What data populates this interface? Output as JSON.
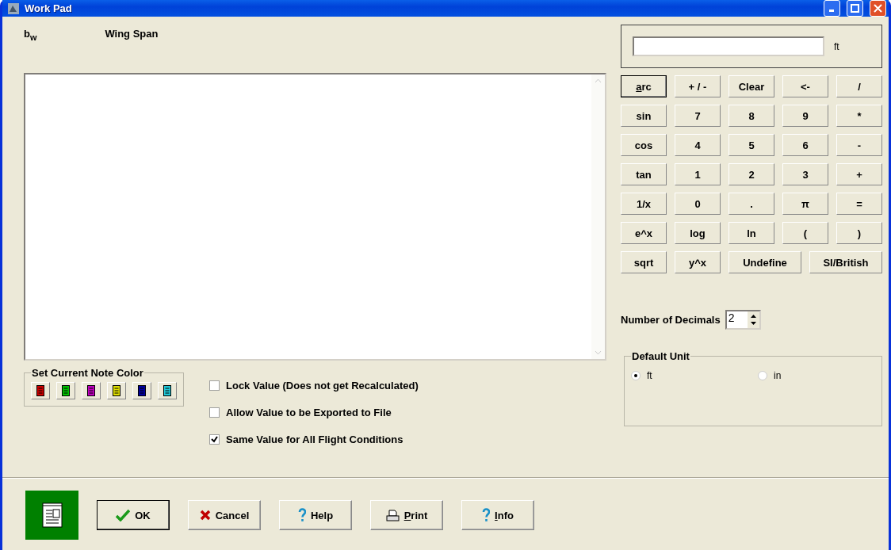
{
  "window": {
    "title": "Work Pad"
  },
  "variable": {
    "symbol": "b",
    "subscript": "w",
    "name": "Wing Span"
  },
  "note_colors": {
    "title": "Set Current Note Color",
    "items": [
      {
        "color": "#d00000"
      },
      {
        "color": "#00c000"
      },
      {
        "color": "#c000c0"
      },
      {
        "color": "#e0e000"
      },
      {
        "color": "#0000a0"
      },
      {
        "color": "#20c8d8"
      }
    ]
  },
  "options": [
    {
      "label": "Lock Value (Does not get Recalculated)",
      "checked": false
    },
    {
      "label": "Allow Value to be Exported to File",
      "checked": false
    },
    {
      "label": "Same Value for All Flight Conditions",
      "checked": true
    }
  ],
  "calculator": {
    "unit": "ft",
    "keys": [
      [
        {
          "label": "arc",
          "kind": "key",
          "underline_first": true,
          "selected": true
        },
        {
          "label": "+ / -",
          "kind": "key"
        },
        {
          "label": "Clear",
          "kind": "key"
        },
        {
          "label": "<-",
          "kind": "key"
        },
        {
          "label": "/",
          "kind": "key"
        }
      ],
      [
        {
          "label": "sin",
          "kind": "key"
        },
        {
          "label": "7",
          "kind": "key"
        },
        {
          "label": "8",
          "kind": "key"
        },
        {
          "label": "9",
          "kind": "key"
        },
        {
          "label": "*",
          "kind": "key"
        }
      ],
      [
        {
          "label": "cos",
          "kind": "key"
        },
        {
          "label": "4",
          "kind": "key"
        },
        {
          "label": "5",
          "kind": "key"
        },
        {
          "label": "6",
          "kind": "key"
        },
        {
          "label": "-",
          "kind": "key"
        }
      ],
      [
        {
          "label": "tan",
          "kind": "key"
        },
        {
          "label": "1",
          "kind": "key"
        },
        {
          "label": "2",
          "kind": "key"
        },
        {
          "label": "3",
          "kind": "key"
        },
        {
          "label": "+",
          "kind": "key"
        }
      ],
      [
        {
          "label": "1/x",
          "kind": "key"
        },
        {
          "label": "0",
          "kind": "key"
        },
        {
          "label": ".",
          "kind": "key"
        },
        {
          "label": "π",
          "kind": "key"
        },
        {
          "label": "=",
          "kind": "key"
        }
      ],
      [
        {
          "label": "e^x",
          "kind": "key"
        },
        {
          "label": "log",
          "kind": "key"
        },
        {
          "label": "ln",
          "kind": "key"
        },
        {
          "label": "(",
          "kind": "key"
        },
        {
          "label": ")",
          "kind": "key"
        }
      ],
      [
        {
          "label": "sqrt",
          "kind": "key"
        },
        {
          "label": "y^x",
          "kind": "key"
        },
        {
          "label": "Undefine",
          "kind": "wide"
        },
        {
          "label": "SI/British",
          "kind": "wide"
        }
      ]
    ]
  },
  "decimals": {
    "label": "Number of Decimals",
    "value": "2"
  },
  "default_unit": {
    "title": "Default Unit",
    "options": [
      {
        "label": "ft",
        "selected": true
      },
      {
        "label": "in",
        "selected": false
      }
    ]
  },
  "buttons": [
    {
      "label": "OK",
      "kind": "ok",
      "default": true
    },
    {
      "label": "Cancel",
      "kind": "cancel"
    },
    {
      "label": "Help",
      "kind": "help"
    },
    {
      "label": "Print",
      "kind": "print",
      "underline_first": true
    },
    {
      "label": "Info",
      "kind": "help",
      "underline_first": true
    }
  ]
}
